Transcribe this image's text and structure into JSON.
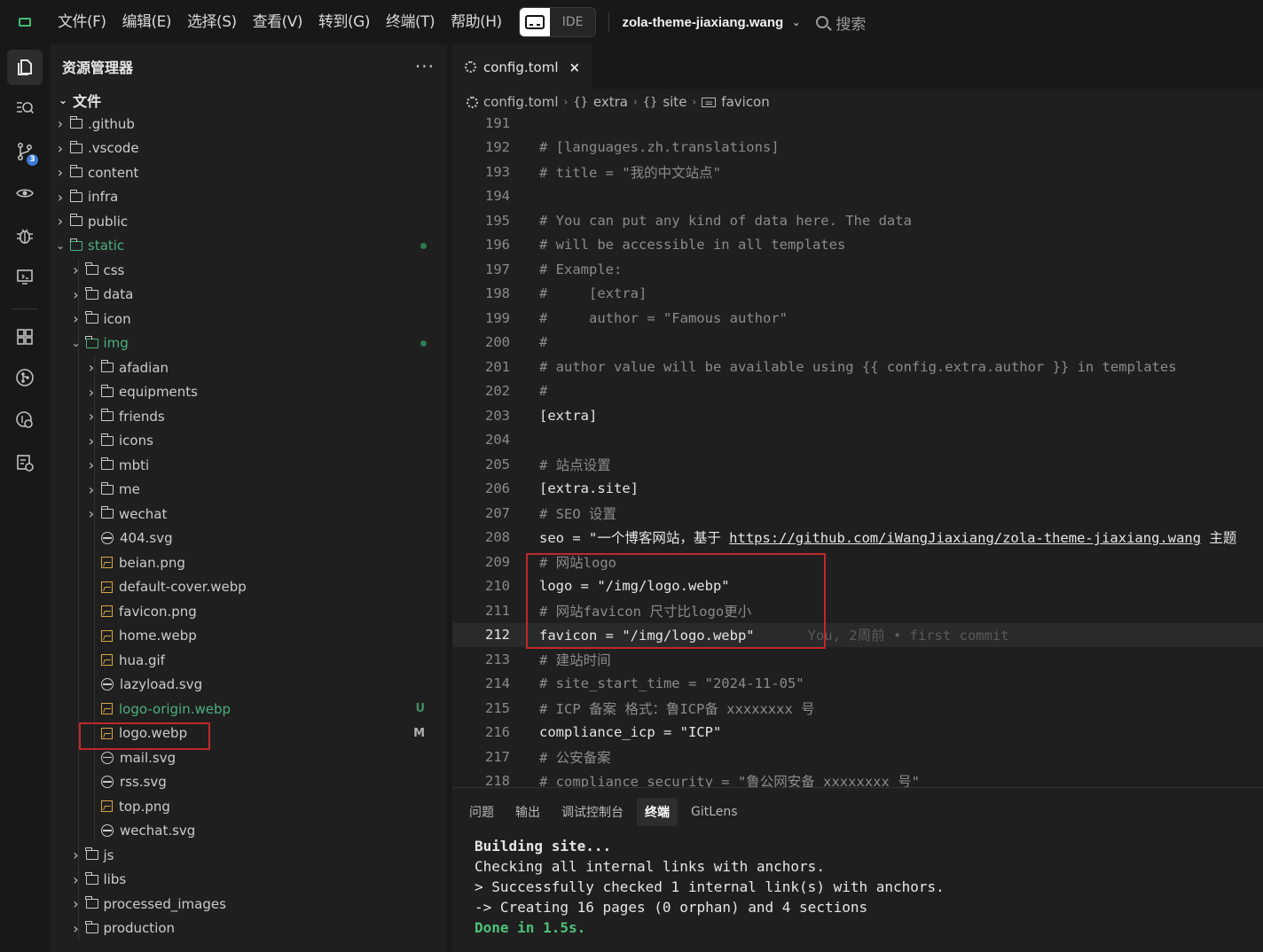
{
  "menu": [
    "文件(F)",
    "编辑(E)",
    "选择(S)",
    "查看(V)",
    "转到(G)",
    "终端(T)",
    "帮助(H)"
  ],
  "ide_label": "IDE",
  "workspace": "zola-theme-jiaxiang.wang",
  "search_placeholder": "搜索",
  "activity": {
    "scm_badge": "3"
  },
  "sidebar": {
    "title": "资源管理器",
    "more": "···",
    "section": "文件",
    "tree": [
      {
        "label": ".github",
        "kind": "folder"
      },
      {
        "label": ".vscode",
        "kind": "folder"
      },
      {
        "label": "content",
        "kind": "folder"
      },
      {
        "label": "infra",
        "kind": "folder"
      },
      {
        "label": "public",
        "kind": "folder"
      },
      {
        "label": "static",
        "kind": "folder-open"
      },
      {
        "label": "css",
        "kind": "folder"
      },
      {
        "label": "data",
        "kind": "folder"
      },
      {
        "label": "icon",
        "kind": "folder"
      },
      {
        "label": "img",
        "kind": "folder-open"
      },
      {
        "label": "afadian",
        "kind": "folder"
      },
      {
        "label": "equipments",
        "kind": "folder"
      },
      {
        "label": "friends",
        "kind": "folder"
      },
      {
        "label": "icons",
        "kind": "folder"
      },
      {
        "label": "mbti",
        "kind": "folder"
      },
      {
        "label": "me",
        "kind": "folder"
      },
      {
        "label": "wechat",
        "kind": "folder"
      },
      {
        "label": "404.svg",
        "kind": "svg"
      },
      {
        "label": "beian.png",
        "kind": "image"
      },
      {
        "label": "default-cover.webp",
        "kind": "image"
      },
      {
        "label": "favicon.png",
        "kind": "image"
      },
      {
        "label": "home.webp",
        "kind": "image"
      },
      {
        "label": "hua.gif",
        "kind": "image"
      },
      {
        "label": "lazyload.svg",
        "kind": "svg"
      },
      {
        "label": "logo-origin.webp",
        "kind": "image",
        "status": "U"
      },
      {
        "label": "logo.webp",
        "kind": "image",
        "status": "M"
      },
      {
        "label": "mail.svg",
        "kind": "svg"
      },
      {
        "label": "rss.svg",
        "kind": "svg"
      },
      {
        "label": "top.png",
        "kind": "image"
      },
      {
        "label": "wechat.svg",
        "kind": "svg"
      },
      {
        "label": "js",
        "kind": "folder"
      },
      {
        "label": "libs",
        "kind": "folder"
      },
      {
        "label": "processed_images",
        "kind": "folder"
      },
      {
        "label": "production",
        "kind": "folder"
      }
    ]
  },
  "editor": {
    "tab_label": "config.toml",
    "tab_close": "×",
    "breadcrumb": [
      "config.toml",
      "extra",
      "site",
      "favicon"
    ],
    "lines": [
      {
        "n": "191",
        "t": ""
      },
      {
        "n": "192",
        "t": "# [languages.zh.translations]"
      },
      {
        "n": "193",
        "t": "# title = \"我的中文站点\""
      },
      {
        "n": "194",
        "t": ""
      },
      {
        "n": "195",
        "t": "# You can put any kind of data here. The data"
      },
      {
        "n": "196",
        "t": "# will be accessible in all templates"
      },
      {
        "n": "197",
        "t": "# Example:"
      },
      {
        "n": "198",
        "t": "#     [extra]"
      },
      {
        "n": "199",
        "t": "#     author = \"Famous author\""
      },
      {
        "n": "200",
        "t": "#"
      },
      {
        "n": "201",
        "t": "# author value will be available using {{ config.extra.author }} in templates"
      },
      {
        "n": "202",
        "t": "#"
      },
      {
        "n": "203",
        "t": "[extra]"
      },
      {
        "n": "204",
        "t": ""
      },
      {
        "n": "205",
        "t": "# 站点设置"
      },
      {
        "n": "206",
        "t": "[extra.site]"
      },
      {
        "n": "207",
        "t": "# SEO 设置"
      },
      {
        "n": "208",
        "t": "seo = \"一个博客网站，基于 ",
        "url": "https://github.com/iWangJiaxiang/zola-theme-jiaxiang.wang",
        "tail": " 主题"
      },
      {
        "n": "209",
        "t": "# 网站logo"
      },
      {
        "n": "210",
        "t": "logo = \"/img/logo.webp\""
      },
      {
        "n": "211",
        "t": "# 网站favicon 尺寸比logo更小"
      },
      {
        "n": "212",
        "t": "favicon = \"/img/logo.webp\"",
        "blame": "You, 2周前 • first commit"
      },
      {
        "n": "213",
        "t": "# 建站时间"
      },
      {
        "n": "214",
        "t": "# site_start_time = \"2024-11-05\""
      },
      {
        "n": "215",
        "t": "# ICP 备案 格式：鲁ICP备 xxxxxxxx 号"
      },
      {
        "n": "216",
        "t": "compliance_icp = \"ICP\""
      },
      {
        "n": "217",
        "t": "# 公安备案"
      },
      {
        "n": "218",
        "t": "# compliance_security = \"鲁公网安备 xxxxxxxx 号\""
      }
    ]
  },
  "panel": {
    "tabs": [
      "问题",
      "输出",
      "调试控制台",
      "终端",
      "GitLens"
    ],
    "active_tab": "终端",
    "terminal": [
      "Building site...",
      "Checking all internal links with anchors.",
      "> Successfully checked 1 internal link(s) with anchors.",
      "-> Creating 16 pages (0 orphan) and 4 sections",
      "Done in 1.5s."
    ]
  }
}
